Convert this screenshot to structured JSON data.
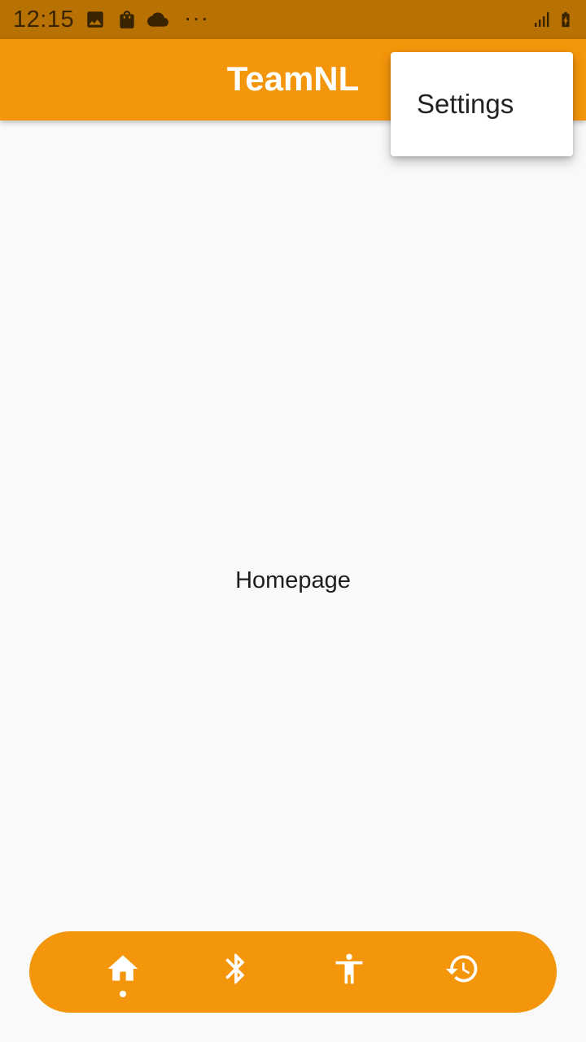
{
  "status_bar": {
    "time": "12:15",
    "overflow_indicator": "···",
    "icons": [
      "image-icon",
      "shopping-bag-icon",
      "cloud-icon",
      "signal-icon",
      "battery-charging-icon"
    ]
  },
  "app_bar": {
    "title": "TeamNL"
  },
  "menu": {
    "items": [
      {
        "label": "Settings"
      }
    ]
  },
  "main": {
    "text": "Homepage"
  },
  "bottom_nav": {
    "items": [
      {
        "icon": "home-icon",
        "active": true
      },
      {
        "icon": "bluetooth-icon",
        "active": false
      },
      {
        "icon": "accessibility-icon",
        "active": false
      },
      {
        "icon": "history-icon",
        "active": false
      }
    ]
  },
  "colors": {
    "status_bar": "#b87103",
    "primary": "#f4960b",
    "background": "#f9f9f9",
    "menu_background": "#ffffff"
  }
}
